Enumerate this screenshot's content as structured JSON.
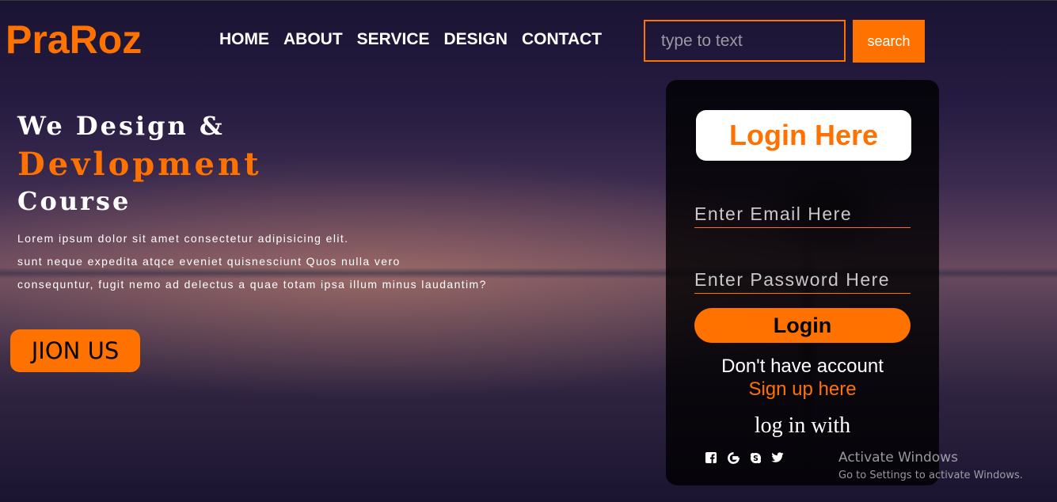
{
  "brand": {
    "logo_text": "PraRoz",
    "accent_color": "#ff7200"
  },
  "nav": {
    "items": [
      {
        "label": "HOME"
      },
      {
        "label": "ABOUT"
      },
      {
        "label": "SERVICE"
      },
      {
        "label": "DESIGN"
      },
      {
        "label": "CONTACT"
      }
    ]
  },
  "search": {
    "placeholder": "type to text",
    "value": "",
    "button_label": "search"
  },
  "hero": {
    "line1": "We Design &",
    "line2": "Devlopment",
    "line3": "Course",
    "paragraph": [
      "Lorem ipsum dolor sit amet consectetur adipisicing elit.",
      "sunt neque expedita atqce eveniet quisnesciunt Quos nulla vero",
      "consequntur, fugit nemo ad delectus a quae totam ipsa illum minus laudantim?"
    ],
    "join_label": "JION US"
  },
  "login": {
    "title": "Login Here",
    "email_placeholder": "Enter Email Here",
    "password_placeholder": "Enter Password Here",
    "button_label": "Login",
    "no_account_text": "Don't have account",
    "signup_text": "Sign up here",
    "login_with_text": "log in with",
    "social": [
      {
        "name": "facebook-icon"
      },
      {
        "name": "google-icon"
      },
      {
        "name": "skype-icon"
      },
      {
        "name": "twitter-icon"
      }
    ]
  },
  "watermark": {
    "title": "Activate Windows",
    "subtitle": "Go to Settings to activate Windows."
  }
}
